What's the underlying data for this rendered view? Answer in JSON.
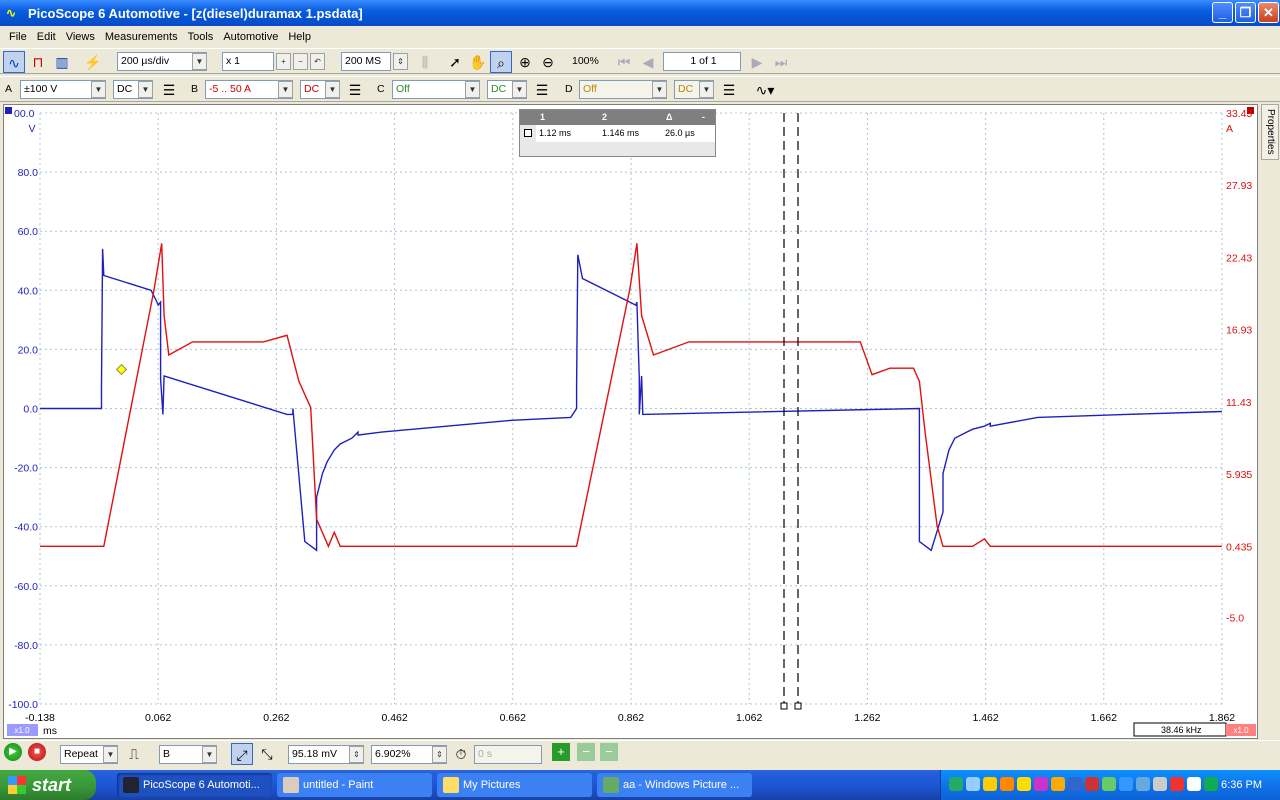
{
  "window": {
    "title": "PicoScope 6 Automotive - [z(diesel)duramax 1.psdata]"
  },
  "menu": [
    "File",
    "Edit",
    "Views",
    "Measurements",
    "Tools",
    "Automotive",
    "Help"
  ],
  "toolbar": {
    "timebase": "200 µs/div",
    "zoom_factor": "x 1",
    "samples": "200 MS",
    "zoom_pct": "100%",
    "page": "1 of 1"
  },
  "channels": {
    "a": {
      "label": "A",
      "range": "±100 V",
      "coupling": "DC"
    },
    "b": {
      "label": "B",
      "range": "-5 .. 50 A",
      "coupling": "DC"
    },
    "c": {
      "label": "C",
      "range": "Off",
      "coupling": "DC"
    },
    "d": {
      "label": "D",
      "range": "Off",
      "coupling": "DC"
    }
  },
  "ruler_table": {
    "headers": [
      "1",
      "2",
      "Δ",
      "-"
    ],
    "values": [
      "1.12 ms",
      "1.146 ms",
      "26.0 µs"
    ]
  },
  "axes": {
    "left_ticks": [
      "00.0",
      "80.0",
      "60.0",
      "40.0",
      "20.0",
      "0.0",
      "-20.0",
      "-40.0",
      "-60.0",
      "-80.0",
      "-100.0"
    ],
    "left_unit": "V",
    "right_ticks": [
      "33.43",
      "27.93",
      "22.43",
      "16.93",
      "11.43",
      "5.935",
      "0.435",
      "-5.0"
    ],
    "right_unit": "A",
    "x_ticks": [
      "-0.138",
      "0.062",
      "0.262",
      "0.462",
      "0.662",
      "0.862",
      "1.062",
      "1.262",
      "1.462",
      "1.662",
      "1.862"
    ],
    "x_unit": "ms",
    "x_left_badge": "x1.0",
    "x_right_badge": "x1.0",
    "freq_readout": "38.46 kHz"
  },
  "chart_data": {
    "type": "line",
    "x_unit": "ms",
    "xlim": [
      -0.138,
      1.862
    ],
    "ylim_left": [
      -100,
      100
    ],
    "ylim_right": [
      -11.57,
      33.43
    ],
    "series": [
      {
        "color": "#1f1fbf",
        "axis": "left",
        "x": [
          -0.138,
          -0.034,
          -0.034,
          -0.032,
          -0.03,
          0.05,
          0.06,
          0.062,
          0.066,
          0.066,
          0.07,
          0.072,
          0.28,
          0.29,
          0.29,
          0.31,
          0.33,
          0.33,
          0.34,
          0.348,
          0.36,
          0.37,
          0.39,
          0.4,
          0.4,
          0.44,
          0.55,
          0.66,
          0.76,
          0.77,
          0.77,
          0.772,
          0.78,
          0.86,
          0.87,
          0.872,
          0.876,
          0.876,
          0.88,
          0.882,
          1.35,
          1.35,
          1.37,
          1.39,
          1.39,
          1.4,
          1.41,
          1.43,
          1.44,
          1.46,
          1.47,
          1.47,
          1.55,
          1.7,
          1.862
        ],
        "y": [
          0,
          0,
          8,
          54,
          45,
          40,
          36,
          35,
          36,
          10,
          -2,
          11,
          -2,
          -2,
          0,
          -45,
          -48,
          -30,
          -22,
          -18,
          -14,
          -12,
          -10,
          -8,
          -9,
          -8,
          -6,
          -4,
          -3,
          0,
          8,
          52,
          44,
          36,
          35,
          36,
          10,
          -2,
          11,
          -2,
          0,
          -45,
          -48,
          -35,
          -22,
          -14,
          -10,
          -8,
          -7,
          -6,
          -5,
          -6,
          -3,
          -2,
          -1
        ]
      },
      {
        "color": "#e01010",
        "axis": "right",
        "x": [
          -0.138,
          -0.035,
          -0.03,
          0.055,
          0.068,
          0.072,
          0.08,
          0.12,
          0.16,
          0.2,
          0.24,
          0.28,
          0.3,
          0.32,
          0.33,
          0.35,
          0.36,
          0.37,
          0.38,
          0.4,
          0.55,
          0.7,
          0.76,
          0.77,
          0.86,
          0.872,
          0.88,
          0.9,
          0.96,
          1.03,
          1.1,
          1.16,
          1.2,
          1.25,
          1.27,
          1.3,
          1.34,
          1.35,
          1.36,
          1.38,
          1.39,
          1.4,
          1.44,
          1.46,
          1.47,
          1.48,
          1.6,
          1.862
        ],
        "y": [
          0.44,
          0.44,
          0.44,
          20,
          23.5,
          18,
          15,
          16,
          16,
          16,
          16,
          16.5,
          13,
          11,
          2.5,
          0.44,
          1.5,
          0.44,
          0.44,
          0.44,
          0.44,
          0.44,
          0.44,
          0.44,
          20,
          23.5,
          18,
          15,
          16,
          16,
          16,
          16,
          16,
          16,
          13.5,
          14,
          14,
          13,
          9,
          2,
          0.44,
          0.44,
          0.44,
          1,
          0.44,
          0.44,
          0.44,
          0.44
        ]
      }
    ]
  },
  "status": {
    "trigger_mode": "Repeat",
    "trigger_channel": "B",
    "threshold": "95.18 mV",
    "pretrigger": "6.902%",
    "delay": "0 s"
  },
  "sidebar": {
    "properties_label": "Properties"
  },
  "taskbar": {
    "start_label": "start",
    "tasks": [
      {
        "label": "PicoScope 6 Automoti..."
      },
      {
        "label": "untitled - Paint"
      },
      {
        "label": "My Pictures"
      },
      {
        "label": "aa - Windows Picture ..."
      }
    ],
    "clock": "6:36 PM"
  }
}
